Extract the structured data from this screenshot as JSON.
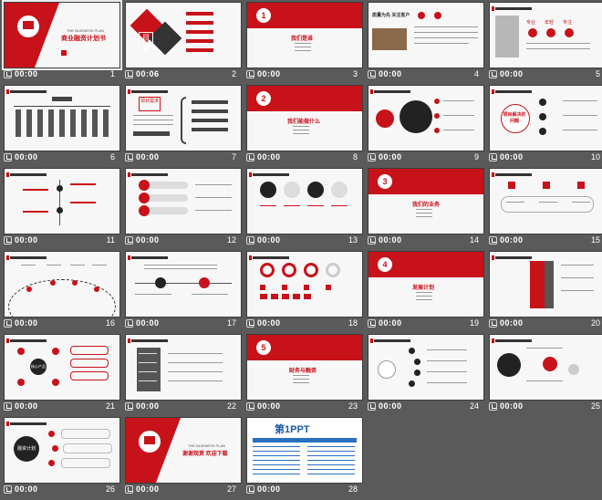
{
  "slides": [
    {
      "num": "1",
      "time": "00:00",
      "title": "商业融资计划书",
      "subtitle": "THE BUSINESS PLAN"
    },
    {
      "num": "2",
      "time": "00:06",
      "title": "目录"
    },
    {
      "num": "3",
      "time": "00:00",
      "title": "我们是谁",
      "section": "1"
    },
    {
      "num": "4",
      "time": "00:00",
      "title": "质量为先 关注客户"
    },
    {
      "num": "5",
      "time": "00:00",
      "labels": [
        "专业",
        "年轻",
        "专注"
      ]
    },
    {
      "num": "6",
      "time": "00:00"
    },
    {
      "num": "7",
      "time": "00:00",
      "title": "现状需求"
    },
    {
      "num": "8",
      "time": "00:00",
      "title": "我们能做什么",
      "section": "2"
    },
    {
      "num": "9",
      "time": "00:00"
    },
    {
      "num": "10",
      "time": "00:00",
      "title": "项目解决的问题"
    },
    {
      "num": "11",
      "time": "00:00"
    },
    {
      "num": "12",
      "time": "00:00"
    },
    {
      "num": "13",
      "time": "00:00"
    },
    {
      "num": "14",
      "time": "00:00",
      "title": "我们的业务",
      "section": "3"
    },
    {
      "num": "15",
      "time": "00:00"
    },
    {
      "num": "16",
      "time": "00:00"
    },
    {
      "num": "17",
      "time": "00:00"
    },
    {
      "num": "18",
      "time": "00:00"
    },
    {
      "num": "19",
      "time": "00:00",
      "title": "发展计划",
      "section": "4"
    },
    {
      "num": "20",
      "time": "00:00"
    },
    {
      "num": "21",
      "time": "00:00",
      "title": "核心产品"
    },
    {
      "num": "22",
      "time": "00:00"
    },
    {
      "num": "23",
      "time": "00:00",
      "title": "财务与融资",
      "section": "5"
    },
    {
      "num": "24",
      "time": "00:00"
    },
    {
      "num": "25",
      "time": "00:00"
    },
    {
      "num": "26",
      "time": "00:00",
      "title": "融资计划"
    },
    {
      "num": "27",
      "time": "00:00",
      "title": "谢谢观赏 欢迎下载",
      "subtitle": "THE BUSINESS PLAN"
    },
    {
      "num": "28",
      "time": "00:00",
      "title": "第1PPT"
    }
  ],
  "colors": {
    "accent": "#c8121a",
    "background": "#5a5a5a",
    "text": "#ffffff"
  },
  "icons": {
    "animation": "play-animation-icon"
  }
}
